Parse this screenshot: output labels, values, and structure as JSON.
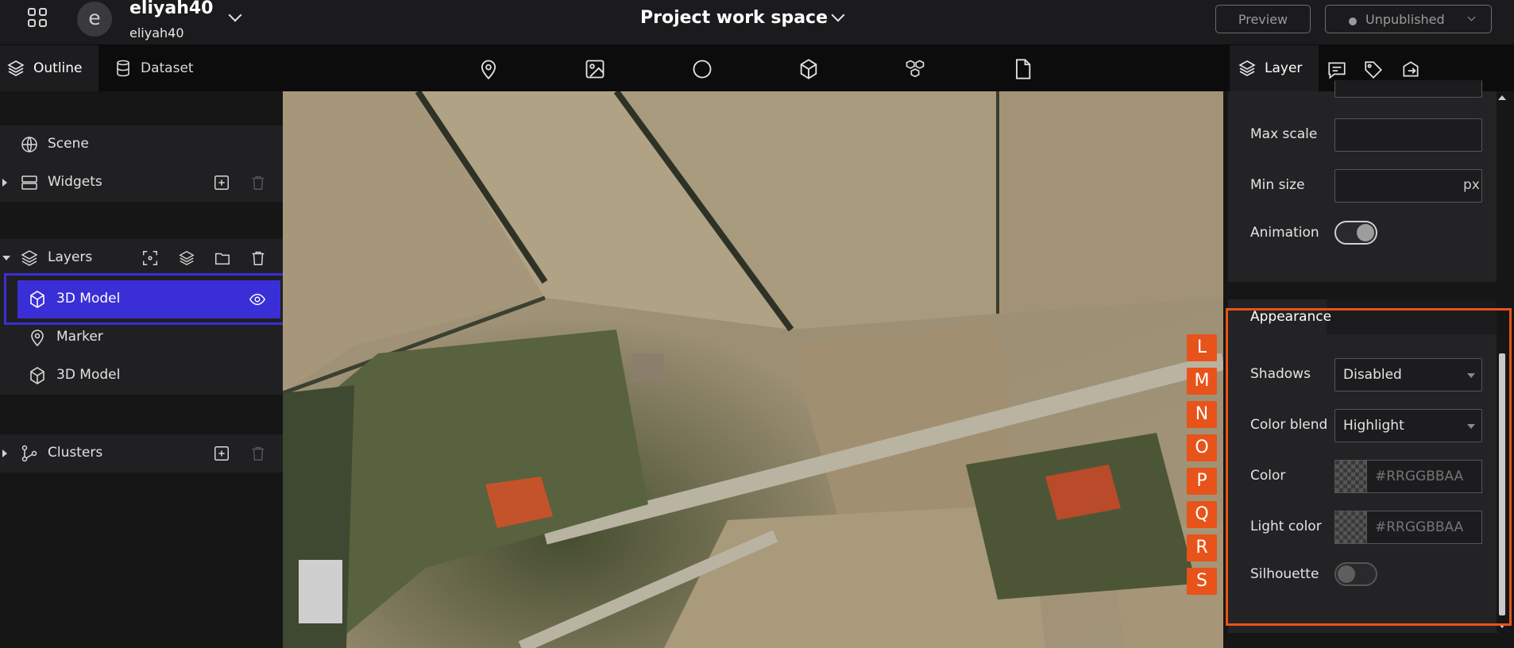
{
  "header": {
    "user_initial": "e",
    "user_name": "eliyah40",
    "user_sub": "eliyah40",
    "project_title": "Project work space",
    "preview_label": "Preview",
    "publish_label": "Unpublished"
  },
  "left_tabs": {
    "outline": "Outline",
    "dataset": "Dataset"
  },
  "right_tabs": {
    "layer": "Layer"
  },
  "toolbar": {
    "tools": [
      "marker-icon",
      "image-icon",
      "circle-icon",
      "box-icon",
      "cubes-icon",
      "file-icon"
    ]
  },
  "outline": {
    "scene": "Scene",
    "widgets": "Widgets",
    "layers": "Layers",
    "layer_items": [
      "3D Model",
      "Marker",
      "3D Model"
    ],
    "clusters": "Clusters"
  },
  "map_markers": [
    "L",
    "M",
    "N",
    "O",
    "P",
    "Q",
    "R",
    "S"
  ],
  "properties": {
    "max_scale_label": "Max scale",
    "min_size_label": "Min size",
    "min_size_unit": "px",
    "animation_label": "Animation",
    "animation_on": true,
    "appearance_title": "Appearance",
    "shadows_label": "Shadows",
    "shadows_value": "Disabled",
    "color_blend_label": "Color blend",
    "color_blend_value": "Highlight",
    "color_label": "Color",
    "color_placeholder": "#RRGGBBAA",
    "light_color_label": "Light color",
    "light_color_placeholder": "#RRGGBBAA",
    "silhouette_label": "Silhouette",
    "silhouette_on": false
  },
  "colors": {
    "selection": "#3a2fd6",
    "highlight_box": "#e8531a",
    "marker_bg": "#e8531a"
  }
}
